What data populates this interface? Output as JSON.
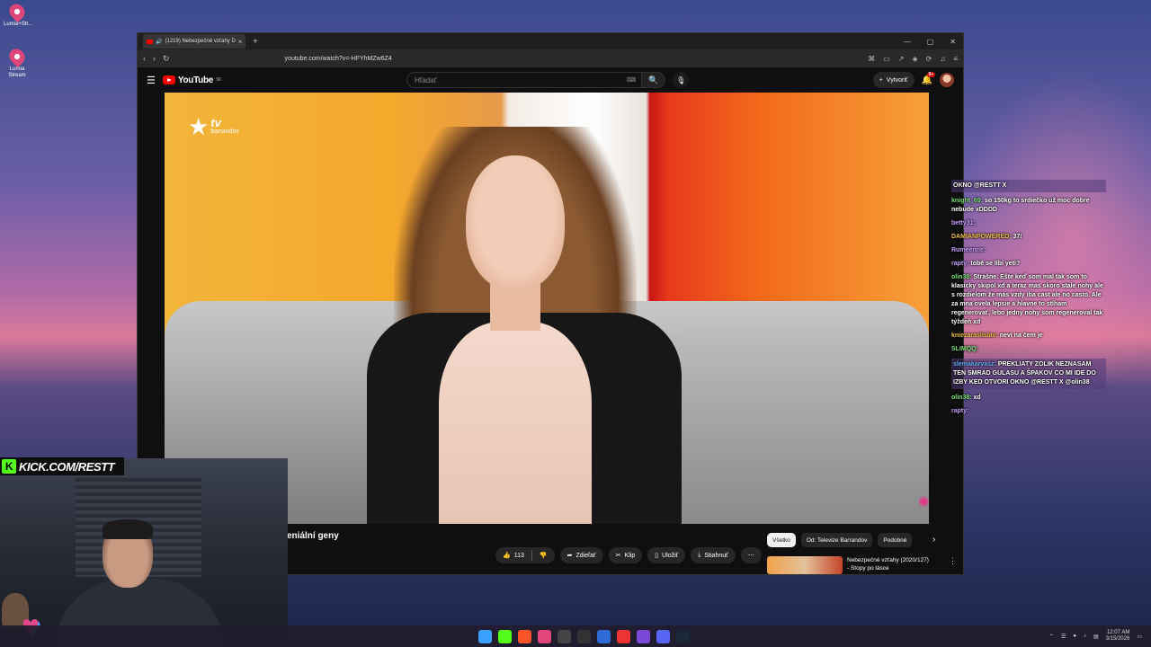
{
  "desktop": {
    "icons": [
      {
        "label": "Lumia+Str...",
        "name": "lumia-stream-icon"
      },
      {
        "label": "Lumia Stream",
        "name": "lumia-stream-icon"
      }
    ]
  },
  "browser": {
    "tab_title": "(1219) Nebezpečné vzťahy D",
    "url": "youtube.com/watch?v=-HFYhMZw6Z4"
  },
  "youtube": {
    "logo_text": "YouTube",
    "region": "SK",
    "search_placeholder": "Hľadať",
    "create_label": "Vytvoriť",
    "notifications": "9+",
    "video": {
      "channel_logo_small": "tv",
      "channel_logo_big": "barrandov",
      "title": "eniální geny",
      "likes": "113",
      "share_label": "Zdieľať",
      "clip_label": "Klip",
      "save_label": "Uložiť",
      "download_label": "Stiahnuť"
    },
    "chips": [
      "Všetko",
      "Od: Televize Barrandov",
      "Podobné"
    ],
    "recommended": {
      "title_line1": "Nebezpečné vzťahy (2020/127)",
      "title_line2": "- Stopy po lásce"
    }
  },
  "chat": [
    {
      "user": "",
      "text": "OKNO @RESTT X",
      "highlight": true,
      "color": "p"
    },
    {
      "user": "knight_69:",
      "text": "so 150kg to srdiečko už moc dobre nebude xDDDD",
      "color": "g"
    },
    {
      "user": "betty31:",
      "text": "",
      "color": "p"
    },
    {
      "user": "DAMIANPOWERED:",
      "text": "37!",
      "color": "y"
    },
    {
      "user": "Rumeenne:",
      "text": "",
      "color": "p"
    },
    {
      "user": "rapty:",
      "text": "tobě se líbí yeti?",
      "color": "p"
    },
    {
      "user": "olin38:",
      "text": "Strašne. Ešte keď som mal tak som to klasicky skipol xd a teraz mas skoro stale nohy ale s rozdielom že más vzdy iba cast ale no casto. Ale za mna ovela lepsie a hlavne to stíham regenerovať, lebo jedny nohy som regeneroval tak týždeň xd",
      "color": "g"
    },
    {
      "user": "kniezaraslislav:",
      "text": "nevi na čem je",
      "color": "y"
    },
    {
      "user": "SLIMQQ:",
      "text": "",
      "color": "g"
    },
    {
      "user": "slemakarvasz:",
      "text": "PREKLIATY ZOLIK NEZNASAM TEN SMRAD GULASU A ŠPAKOV CO MI IDE DO IZBY KED OTVORI OKNO @RESTT X @olin38",
      "highlight": true,
      "color": "b"
    },
    {
      "user": "olin38:",
      "text": "xd",
      "color": "g"
    },
    {
      "user": "rapty:",
      "text": "",
      "color": "p"
    }
  ],
  "stream": {
    "kick_text": "KICK.COM/RESTT"
  },
  "taskbar": {
    "time": "12:07 AM",
    "date": "3/15/2026"
  }
}
